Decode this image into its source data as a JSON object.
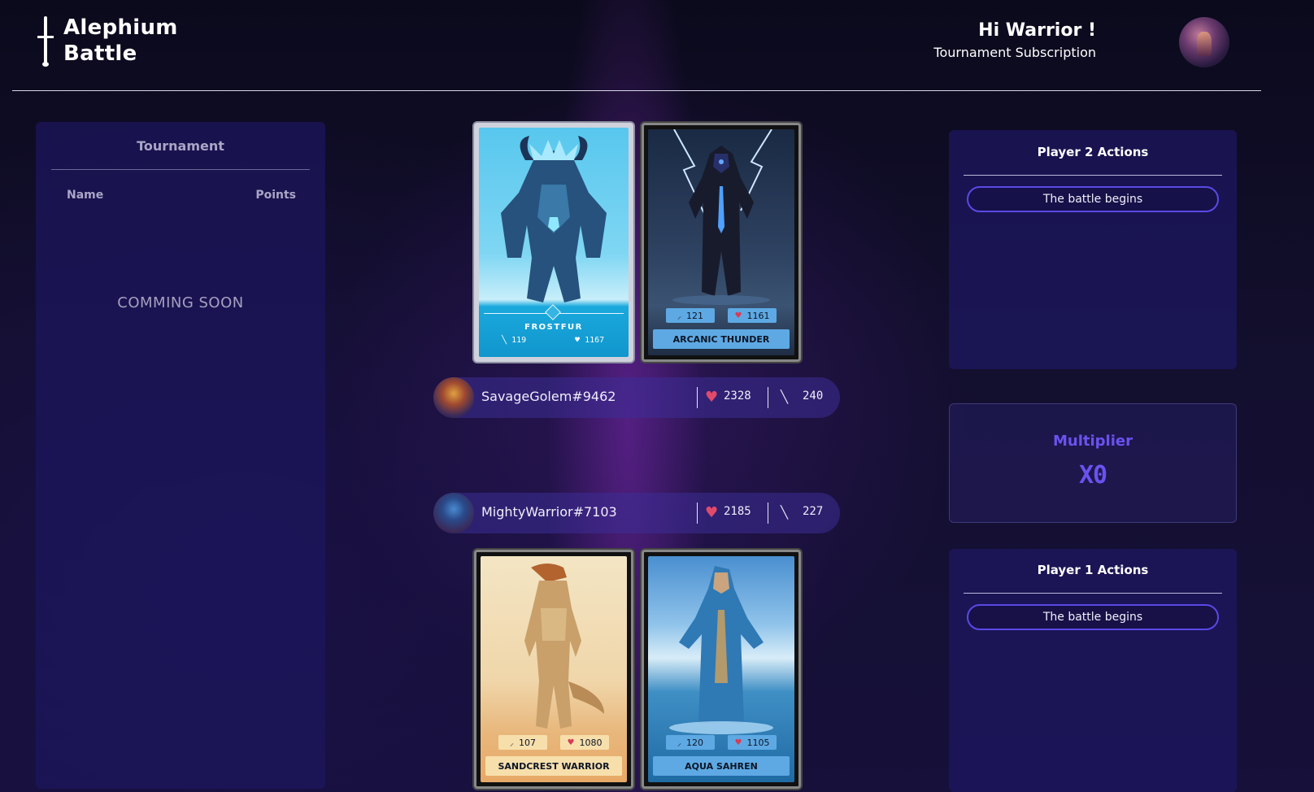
{
  "header": {
    "logo_line1": "Alephium",
    "logo_line2": "Battle",
    "greeting": "Hi Warrior !",
    "subtitle": "Tournament Subscription"
  },
  "tournament": {
    "title": "Tournament",
    "col_name": "Name",
    "col_points": "Points",
    "placeholder": "COMMING SOON"
  },
  "player2": {
    "name": "SavageGolem#9462",
    "health": "2328",
    "attack": "240",
    "cards": [
      {
        "name": "FROSTFUR",
        "attack": "119",
        "health": "1167"
      },
      {
        "name": "ARCANIC THUNDER",
        "attack": "121",
        "health": "1161"
      }
    ]
  },
  "player1": {
    "name": "MightyWarrior#7103",
    "health": "2185",
    "attack": "227",
    "cards": [
      {
        "name": "SANDCREST WARRIOR",
        "attack": "107",
        "health": "1080"
      },
      {
        "name": "AQUA SAHREN",
        "attack": "120",
        "health": "1105"
      }
    ]
  },
  "player2_actions": {
    "title": "Player 2 Actions",
    "entries": [
      "The battle begins"
    ]
  },
  "player1_actions": {
    "title": "Player 1 Actions",
    "entries": [
      "The battle begins"
    ]
  },
  "multiplier": {
    "label": "Multiplier",
    "value": "X0"
  },
  "colors": {
    "accent": "#6a52f0",
    "panel": "#1c165c",
    "health": "#e14a6a"
  }
}
